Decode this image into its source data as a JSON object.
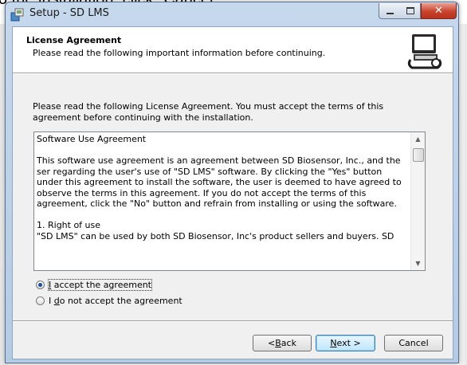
{
  "background": {
    "partial_text": "o the installation, click \"Cancel\"."
  },
  "window": {
    "title": "Setup - SD LMS",
    "controls": {
      "minimize": "minimize",
      "maximize": "maximize",
      "close": "close"
    }
  },
  "header": {
    "title": "License Agreement",
    "subtitle": "Please read the following important information before continuing."
  },
  "intro_text": "Please read the following License Agreement. You must accept the terms of this agreement before continuing with the installation.",
  "license": {
    "text": "Software Use Agreement\n\nThis software use agreement is an agreement between SD Biosensor, Inc., and the ser regarding the user's use of \"SD LMS\" software. By clicking the \"Yes\" button under this agreement to install the software, the user is deemed to have agreed to observe the terms in this agreement. If you do not accept the terms of this agreement, click the \"No\" button and refrain from installing or using the software.\n\n1. Right of use\n\"SD LMS\" can be used by both SD Biosensor, Inc's product sellers and buyers. SD"
  },
  "radios": {
    "accept": {
      "pre": "",
      "accel": "I",
      "post": " accept the agreement",
      "checked": true
    },
    "decline": {
      "pre": "I ",
      "accel": "d",
      "post": "o not accept the agreement",
      "checked": false
    }
  },
  "buttons": {
    "back": {
      "pre": "< ",
      "accel": "B",
      "post": "ack"
    },
    "next": {
      "pre": "",
      "accel": "N",
      "post": "ext >"
    },
    "cancel": "Cancel"
  },
  "colors": {
    "accent": "#1a4fa0",
    "close_button": "#c9432b",
    "titlebar": "#c6d8ec"
  }
}
